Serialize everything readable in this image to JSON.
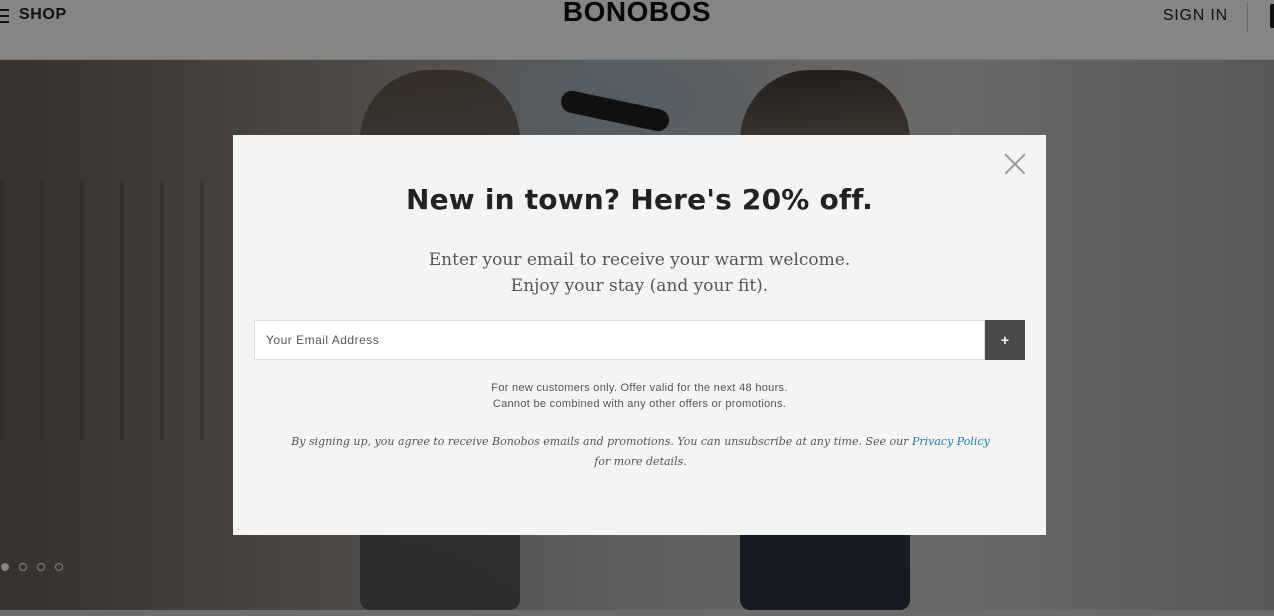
{
  "header": {
    "shop_label": "SHOP",
    "brand": "BONOBOS",
    "signin_label": "SIGN IN"
  },
  "hero": {
    "carousel": {
      "slide_count": 4,
      "active_index": 0
    }
  },
  "modal": {
    "title": "New in town? Here's 20% off.",
    "subtitle_line1": "Enter your email to receive your warm welcome.",
    "subtitle_line2": "Enjoy your stay (and your fit).",
    "email_placeholder": "Your Email Address",
    "submit_label": "+",
    "terms_line1": "For new customers only. Offer valid for the next 48 hours.",
    "terms_line2": "Cannot be combined with any other offers or promotions.",
    "legal_before_link": "By signing up, you agree to receive Bonobos emails and promotions. You can unsubscribe at any time. See our ",
    "privacy_link": "Privacy Policy",
    "legal_after_link": " for more details."
  },
  "colors": {
    "modal_background": "#f4f4f4",
    "submit_button": "#4a4a4a",
    "link": "#1e7fa8",
    "overlay": "rgba(0,0,0,0.48)"
  },
  "icons": {
    "menu": "hamburger-icon",
    "close": "close-icon",
    "bag": "bag-icon"
  }
}
